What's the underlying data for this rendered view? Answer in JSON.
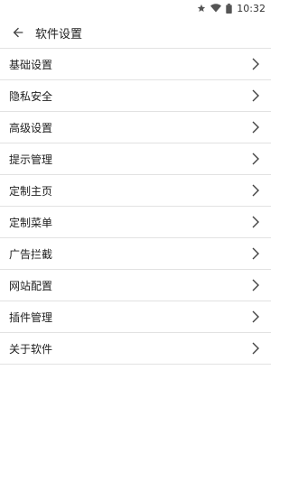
{
  "status_bar": {
    "time": "10:32",
    "icons": [
      "star-icon",
      "wifi-icon",
      "battery-icon"
    ]
  },
  "app_bar": {
    "back_icon": "arrow-left-icon",
    "title": "软件设置"
  },
  "settings": [
    {
      "label": "基础设置",
      "icon": "chevron-right-icon"
    },
    {
      "label": "隐私安全",
      "icon": "chevron-right-icon"
    },
    {
      "label": "高级设置",
      "icon": "chevron-right-icon"
    },
    {
      "label": "提示管理",
      "icon": "chevron-right-icon"
    },
    {
      "label": "定制主页",
      "icon": "chevron-right-icon"
    },
    {
      "label": "定制菜单",
      "icon": "chevron-right-icon"
    },
    {
      "label": "广告拦截",
      "icon": "chevron-right-icon"
    },
    {
      "label": "网站配置",
      "icon": "chevron-right-icon"
    },
    {
      "label": "插件管理",
      "icon": "chevron-right-icon"
    },
    {
      "label": "关于软件",
      "icon": "chevron-right-icon"
    }
  ],
  "colors": {
    "background": "#ffffff",
    "text": "#212121",
    "divider": "#e2e2e2",
    "icon": "#424242"
  }
}
